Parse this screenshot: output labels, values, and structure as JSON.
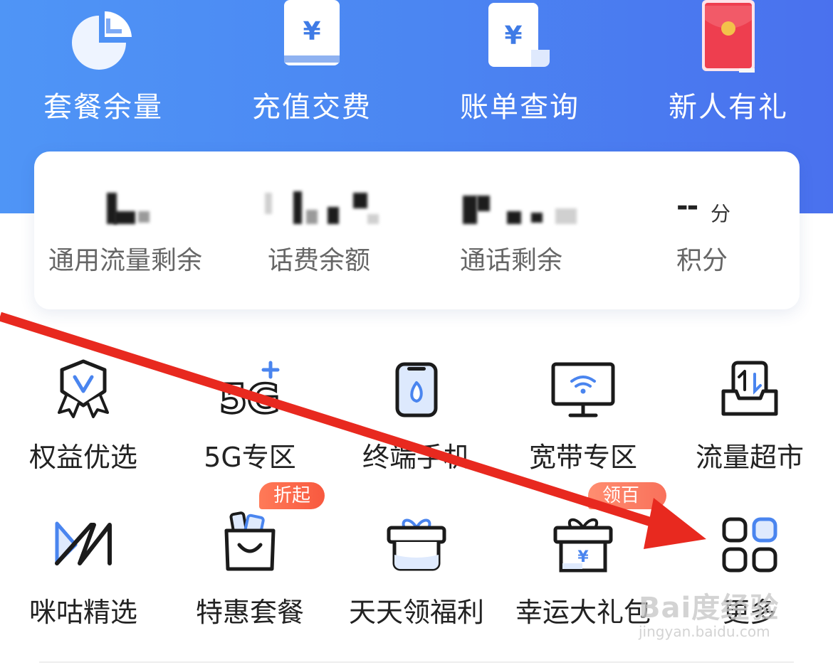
{
  "top_menu": {
    "items": [
      {
        "label": "套餐余量",
        "icon": "pie-chart-icon"
      },
      {
        "label": "充值交费",
        "icon": "yen-card-icon"
      },
      {
        "label": "账单查询",
        "icon": "bill-icon"
      },
      {
        "label": "新人有礼",
        "icon": "red-envelope-icon"
      }
    ]
  },
  "account_card": {
    "stats": [
      {
        "label": "通用流量剩余"
      },
      {
        "label": "话费余额"
      },
      {
        "label": "通话剩余"
      },
      {
        "label": "积分",
        "value": "--",
        "unit": "分"
      }
    ]
  },
  "services": {
    "row1": [
      {
        "label": "权益优选",
        "icon": "v-badge-icon"
      },
      {
        "label": "5G专区",
        "icon": "5g-plus-icon"
      },
      {
        "label": "终端手机",
        "icon": "phone-icon"
      },
      {
        "label": "宽带专区",
        "icon": "monitor-wifi-icon"
      },
      {
        "label": "流量超市",
        "icon": "data-tray-icon"
      }
    ],
    "row2": [
      {
        "label": "咪咕精选",
        "icon": "migu-icon"
      },
      {
        "label": "特惠套餐",
        "icon": "shopping-bag-icon",
        "badge": "折起"
      },
      {
        "label": "天天领福利",
        "icon": "gift-box-icon"
      },
      {
        "label": "幸运大礼包",
        "icon": "gift-yen-icon",
        "badge": "领百元"
      },
      {
        "label": "更多",
        "icon": "grid-more-icon"
      }
    ]
  },
  "watermark": {
    "line1": "Bai度经验",
    "line2": "jingyan.baidu.com"
  },
  "colors": {
    "header_blue": "#4a83f1",
    "arrow_red": "#e8291f",
    "badge_orange": "#f8593f"
  }
}
